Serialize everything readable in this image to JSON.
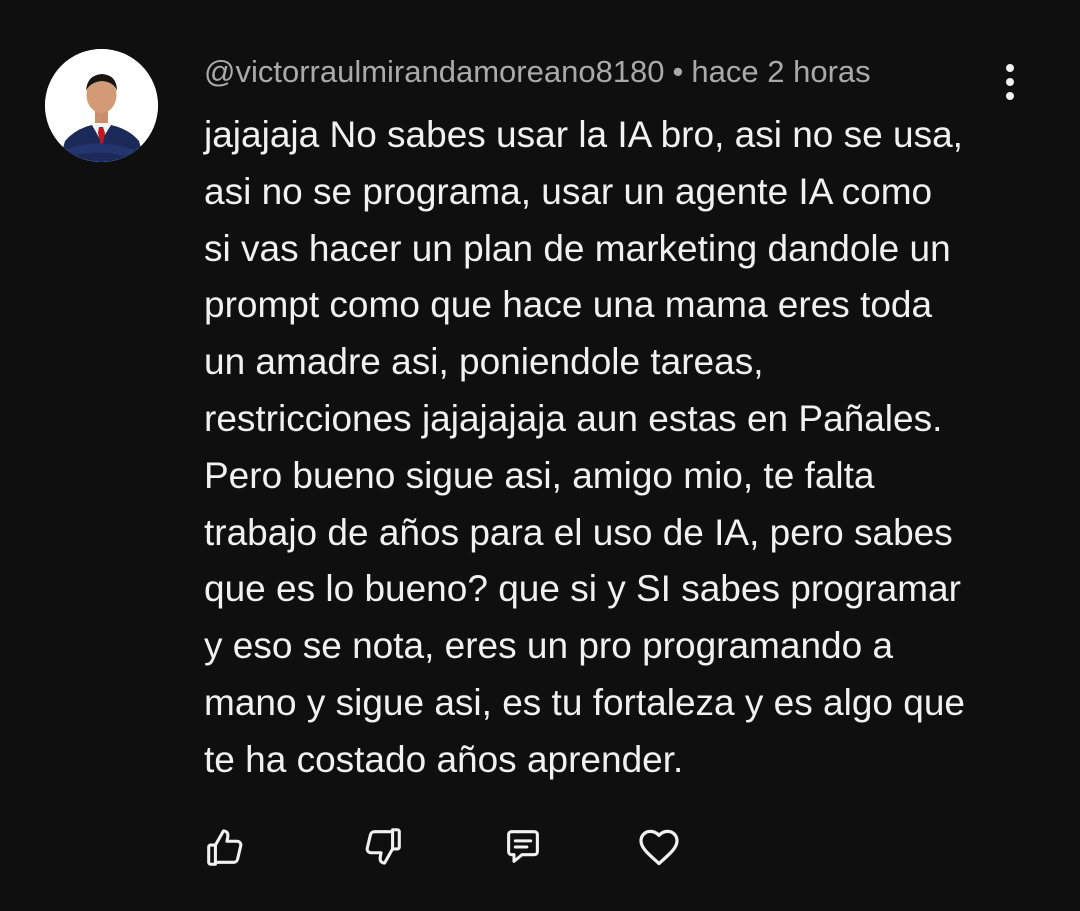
{
  "comment": {
    "author": "@victorraulmirandamoreano8180",
    "separator": "•",
    "time": "hace 2 horas",
    "text_lines": [
      "jajajaja No sabes usar la IA bro, asi no se usa,",
      "asi no se programa, usar un agente IA como",
      "si vas hacer un plan de marketing dandole un",
      "prompt como que hace una mama eres toda",
      "un amadre asi, poniendole tareas,",
      "restricciones jajajajaja aun estas en Pañales.",
      "Pero bueno sigue asi, amigo mio, te falta",
      "trabajo de años para el uso de IA, pero sabes",
      "que es lo bueno? que si y SI sabes programar",
      "y eso se nota, eres un pro programando a",
      "mano y sigue asi, es tu fortaleza y es algo que",
      "te ha costado años aprender."
    ]
  },
  "actions": {
    "icons": [
      "thumbs-up-icon",
      "thumbs-down-icon",
      "reply-icon",
      "heart-icon"
    ]
  },
  "colors": {
    "background": "#0f0f0f",
    "primary_text": "#f1f1f1",
    "secondary_text": "#aaaaaa"
  }
}
